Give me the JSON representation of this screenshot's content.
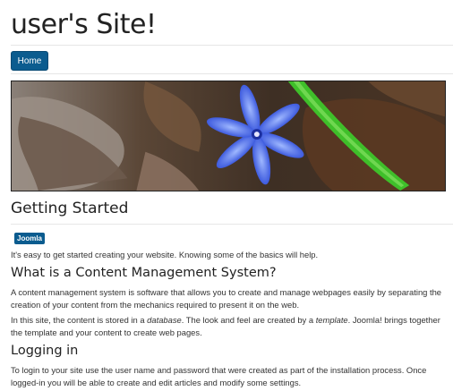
{
  "site": {
    "title": "user's Site!"
  },
  "nav": {
    "home_label": "Home"
  },
  "banner": {
    "alt": "Blue flower on autumn leaves"
  },
  "article": {
    "title": "Getting Started",
    "tag": "Joomla",
    "intro": "It's easy to get started creating your website. Knowing some of the basics will help.",
    "sections": [
      {
        "heading": "What is a Content Management System?",
        "p1": "A content management system is software that allows you to create and manage webpages easily by separating the creation of your content from the mechanics required to present it on the web.",
        "p2_a": "In this site, the content is stored in a ",
        "p2_em1": "database",
        "p2_b": ". The look and feel are created by a ",
        "p2_em2": "template",
        "p2_c": ". Joomla! brings together the template and your content to create web pages."
      },
      {
        "heading": "Logging in",
        "p1": "To login to your site use the user name and password that were created as part of the installation process. Once logged-in you will be able to create and edit articles and modify some settings."
      }
    ]
  },
  "colors": {
    "accent": "#0b5c8f"
  }
}
